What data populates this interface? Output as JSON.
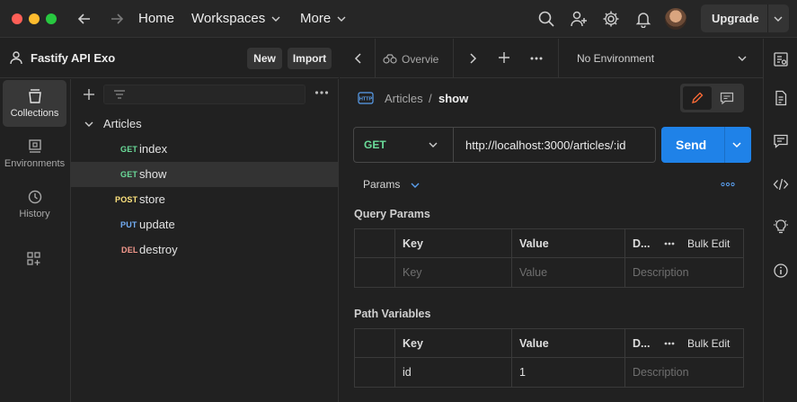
{
  "topbar": {
    "menus": [
      {
        "label": "Home"
      },
      {
        "label": "Workspaces"
      },
      {
        "label": "More"
      }
    ],
    "upgrade_label": "Upgrade"
  },
  "workspace": {
    "name": "Fastify API Exo",
    "new_label": "New",
    "import_label": "Import"
  },
  "rail": {
    "items": [
      {
        "label": "Collections",
        "icon": "collections-icon",
        "active": true
      },
      {
        "label": "Environments",
        "icon": "environments-icon"
      },
      {
        "label": "History",
        "icon": "history-icon"
      }
    ]
  },
  "tree": {
    "collection": "Articles",
    "requests": [
      {
        "method": "GET",
        "name": "index"
      },
      {
        "method": "GET",
        "name": "show",
        "selected": true
      },
      {
        "method": "POST",
        "name": "store"
      },
      {
        "method": "PUT",
        "name": "update"
      },
      {
        "method": "DEL",
        "name": "destroy"
      }
    ]
  },
  "tabs": {
    "overview_label": "Overvie",
    "environment": "No Environment"
  },
  "request": {
    "breadcrumb_parent": "Articles",
    "breadcrumb_sep": "/",
    "breadcrumb_current": "show",
    "method": "GET",
    "url": "http://localhost:3000/articles/:id",
    "send_label": "Send"
  },
  "params": {
    "tab_label": "Params",
    "query_title": "Query Params",
    "path_title": "Path Variables",
    "headers": {
      "key": "Key",
      "value": "Value",
      "desc": "D...",
      "bulk": "Bulk Edit"
    },
    "query_placeholder": {
      "key": "Key",
      "value": "Value",
      "desc": "Description"
    },
    "path_rows": [
      {
        "key": "id",
        "value": "1",
        "desc_placeholder": "Description"
      }
    ]
  },
  "colors": {
    "accent": "#1f82e8",
    "get": "#6bdd9a",
    "post": "#ffe47e",
    "put": "#74aef6",
    "del": "#f79a8e"
  }
}
